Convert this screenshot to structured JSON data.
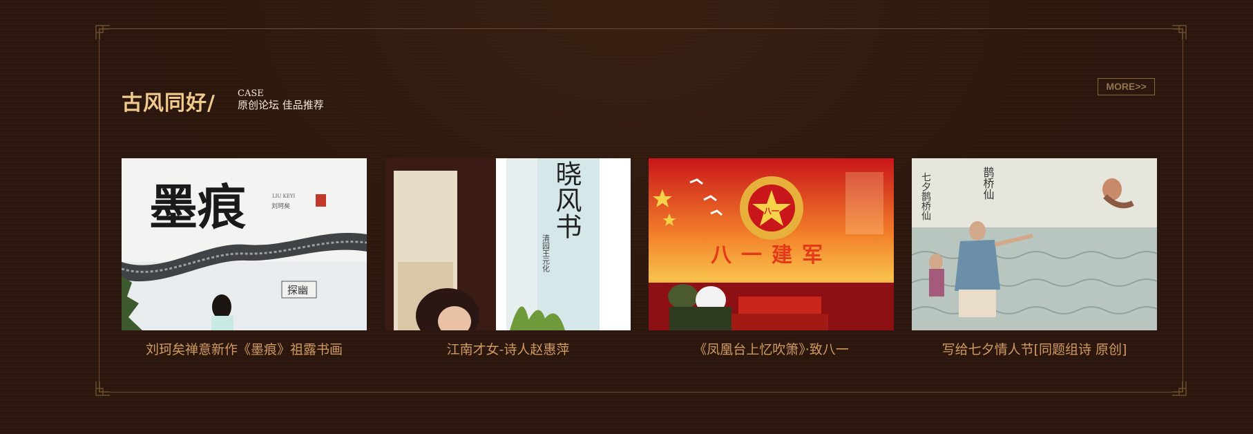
{
  "section": {
    "title": "古风同好/",
    "subtitle_en": "CASE",
    "subtitle_cn": "原创论坛 佳品推荐",
    "more_label": "MORE>>"
  },
  "cards": [
    {
      "caption": "刘珂矣禅意新作《墨痕》祖露书画",
      "image_text": {
        "title": "墨痕",
        "pinyin": "LIU KEYI",
        "name": "刘珂矣",
        "plaque": "探幽"
      }
    },
    {
      "caption": "江南才女-诗人赵惠萍",
      "image_text": {
        "calligraphy": "晓风书",
        "seal_line": "清园王元化"
      }
    },
    {
      "caption": "《凤凰台上忆吹箫》·致八一",
      "image_text": {
        "banner": "八一建军",
        "badge": "八一"
      }
    },
    {
      "caption": "写给七夕情人节[同题组诗 原创]",
      "image_text": {
        "title": "鹊桥仙",
        "poem": "七夕鹊桥仙"
      }
    }
  ],
  "colors": {
    "background": "#2b160c",
    "frame": "#6b4d2a",
    "title": "#f0c98c",
    "caption": "#d09a62",
    "more": "#8f7550"
  }
}
